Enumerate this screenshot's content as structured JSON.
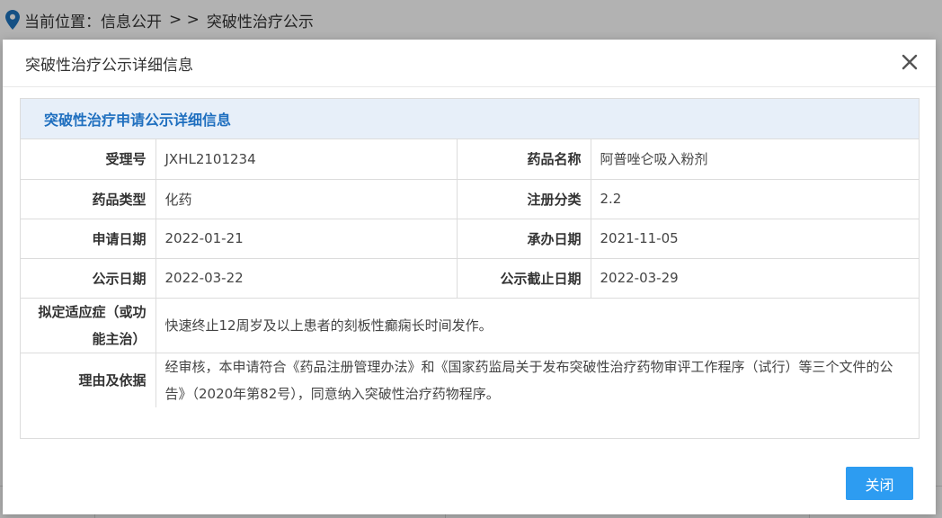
{
  "breadcrumb": {
    "prefix": "当前位置：信息公开",
    "separator": "> >",
    "current": "突破性治疗公示"
  },
  "modal": {
    "title": "突破性治疗公示详细信息",
    "panel_title": "突破性治疗申请公示详细信息",
    "fields": {
      "acceptance_no_label": "受理号",
      "acceptance_no": "JXHL2101234",
      "drug_name_label": "药品名称",
      "drug_name": "阿普唑仑吸入粉剂",
      "drug_type_label": "药品类型",
      "drug_type": "化药",
      "reg_class_label": "注册分类",
      "reg_class": "2.2",
      "apply_date_label": "申请日期",
      "apply_date": "2022-01-21",
      "handle_date_label": "承办日期",
      "handle_date": "2021-11-05",
      "publish_date_label": "公示日期",
      "publish_date": "2022-03-22",
      "publish_end_label": "公示截止日期",
      "publish_end": "2022-03-29",
      "indication_label": "拟定适应症（或功能主治）",
      "indication": "快速终止12周岁及以上患者的刻板性癫痫长时间发作。",
      "reason_label": "理由及依据",
      "reason": "经审核，本申请符合《药品注册管理办法》和《国家药监局关于发布突破性治疗药物审评工作程序（试行）等三个文件的公告》（2020年第82号），同意纳入突破性治疗药物程序。"
    },
    "close_button": "关闭"
  },
  "colors": {
    "accent": "#2d9cf1",
    "panel_header_bg": "#e7eff9",
    "panel_header_text": "#1f6fbf"
  }
}
